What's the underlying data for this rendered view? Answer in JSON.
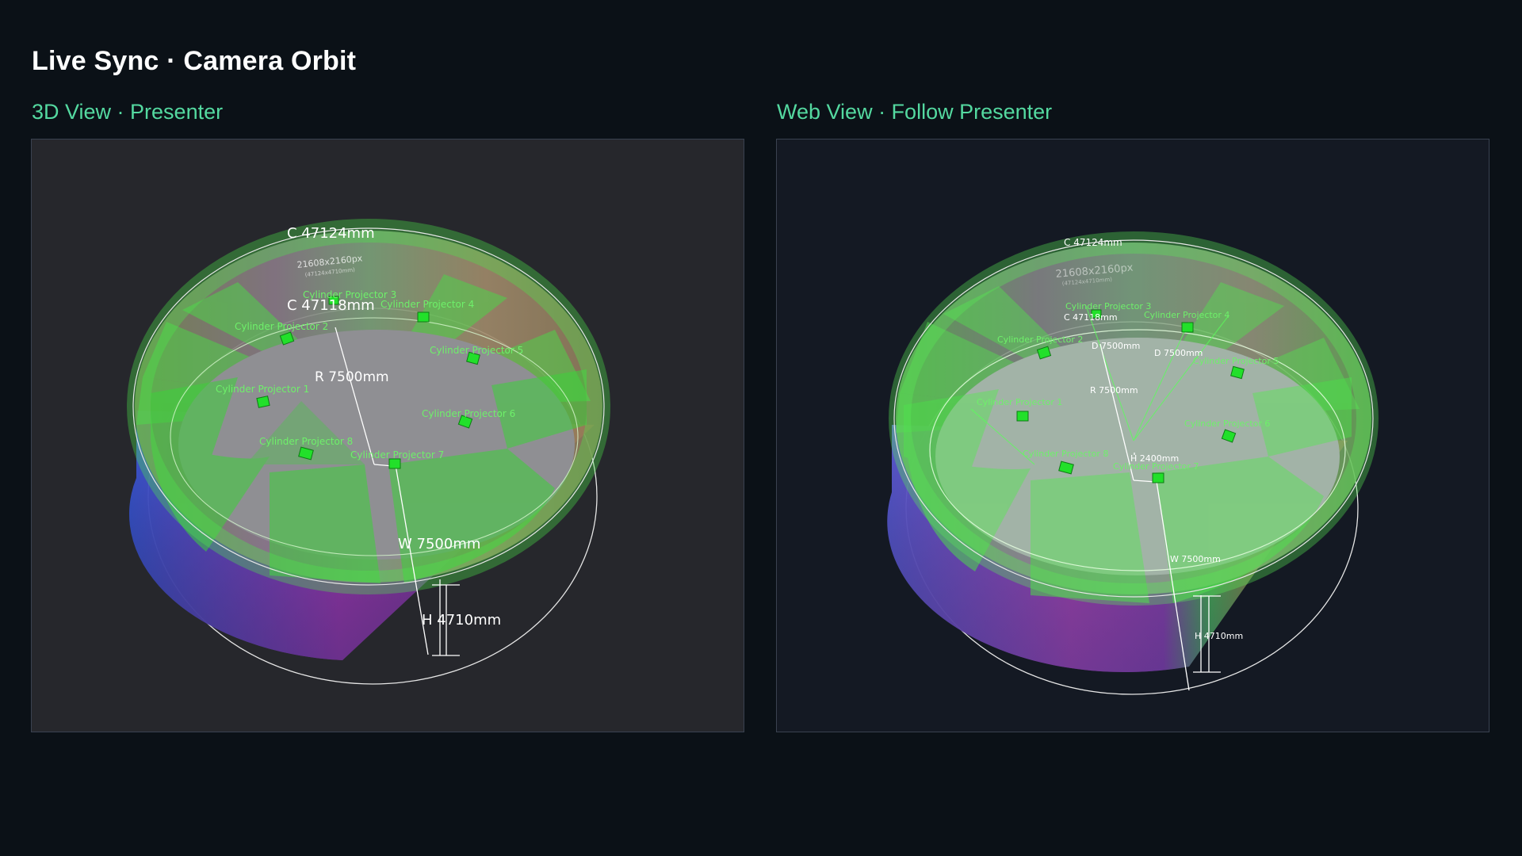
{
  "header": {
    "title": "Live Sync · Camera Orbit"
  },
  "panels": {
    "left": {
      "label": "3D View · Presenter",
      "measurements": {
        "outer_circumference": "C 47124mm",
        "inner_circumference": "C 47118mm",
        "radius": "R 7500mm",
        "width": "W 7500mm",
        "height": "H 4710mm",
        "resolution": "21608x2160px",
        "resolution_sub": "(47124x4710mm)"
      },
      "projectors": [
        "Cylinder Projector 1",
        "Cylinder Projector 2",
        "Cylinder Projector 3",
        "Cylinder Projector 4",
        "Cylinder Projector 5",
        "Cylinder Projector 6",
        "Cylinder Projector 7",
        "Cylinder Projector 8"
      ]
    },
    "right": {
      "label": "Web View · Follow Presenter",
      "measurements": {
        "outer_circumference": "C 47124mm",
        "inner_circumference": "C 47118mm",
        "radius": "R 7500mm",
        "diameter_a": "D 7500mm",
        "diameter_b": "D 7500mm",
        "projector_height": "H 2400mm",
        "width": "W 7500mm",
        "height": "H 4710mm",
        "resolution": "21608x2160px",
        "resolution_sub": "(47124x4710mm)"
      },
      "projectors": [
        "Cylinder Projector 1",
        "Cylinder Projector 2",
        "Cylinder Projector 3",
        "Cylinder Projector 4",
        "Cylinder Projector 5",
        "Cylinder Projector 6",
        "Cylinder Projector 7",
        "Cylinder Projector 8"
      ]
    }
  },
  "colors": {
    "accent": "#54d9a0",
    "projector": "#22e02a",
    "background": "#0b1117"
  }
}
